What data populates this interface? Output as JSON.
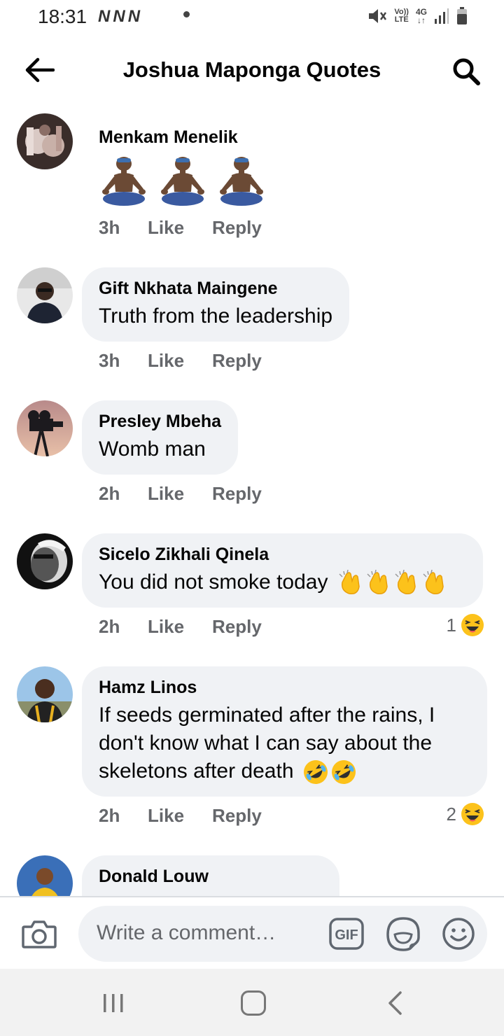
{
  "status_bar": {
    "time": "18:31",
    "network_icons": [
      "N",
      "N",
      "N"
    ],
    "volte": [
      "Vo))",
      "LTE"
    ],
    "network_type": [
      "4G",
      "↓↑"
    ]
  },
  "header": {
    "title": "Joshua Maponga Quotes",
    "back_icon": "arrow-left-icon",
    "search_icon": "search-icon"
  },
  "comments": [
    {
      "author": "Menkam Menelik",
      "text": "",
      "emoji_count": 3,
      "emoji": "person-in-lotus-position",
      "time": "3h",
      "like": "Like",
      "reply": "Reply",
      "reactions": ""
    },
    {
      "author": "Gift Nkhata Maingene",
      "text": "Truth from the leadership",
      "time": "3h",
      "like": "Like",
      "reply": "Reply",
      "reactions": ""
    },
    {
      "author": "Presley Mbeha",
      "text": "Womb man",
      "time": "2h",
      "like": "Like",
      "reply": "Reply",
      "reactions": ""
    },
    {
      "author": "Sicelo Zikhali Qinela",
      "text": "You did not smoke today",
      "trailing_emoji": "clapping-hands",
      "trailing_emoji_count": 4,
      "time": "2h",
      "like": "Like",
      "reply": "Reply",
      "reactions": "1",
      "reaction_icon": "laughing-face-icon"
    },
    {
      "author": "Hamz Linos",
      "text_lines": [
        "If seeds germinated after the rains, I",
        "don't know what I can say about the",
        "skeletons after death"
      ],
      "trailing_emoji": "rolling-on-floor-laughing",
      "trailing_emoji_count": 2,
      "time": "2h",
      "like": "Like",
      "reply": "Reply",
      "reactions": "2",
      "reaction_icon": "laughing-face-icon"
    },
    {
      "author": "Donald Louw",
      "text": ""
    }
  ],
  "composer": {
    "placeholder": "Write a comment…",
    "gif_label": "GIF"
  },
  "colors": {
    "bubble": "#f0f2f5",
    "secondary_text": "#65676b",
    "primary_text": "#050505"
  }
}
